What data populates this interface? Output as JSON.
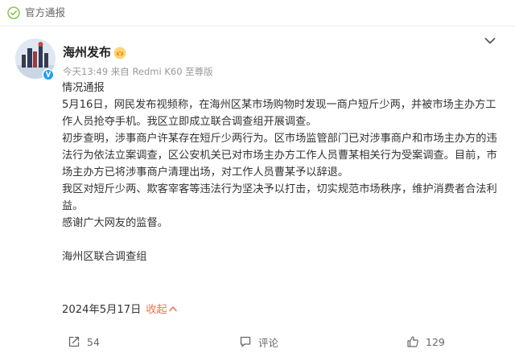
{
  "header": {
    "badge_label": "官方通报"
  },
  "post": {
    "author": "海州发布",
    "meta": "今天13:49 来自 Redmi K60 至尊版",
    "paragraphs": [
      "情况通报",
      "5月16日，网民发布视频称，在海州区某市场购物时发现一商户短斤少两，并被市场主办方工作人员抢夺手机。我区立即成立联合调查组开展调查。",
      "初步查明，涉事商户许某存在短斤少两行为。区市场监管部门已对涉事商户和市场主办方的违法行为依法立案调查，区公安机关已对市场主办方工作人员曹某相关行为受案调查。目前，市场主办方已将涉事商户清理出场，对工作人员曹某予以辞退。",
      "我区对短斤少两、欺客宰客等违法行为坚决予以打击，切实规范市场秩序，维护消费者合法利益。",
      "感谢广大网友的监督。"
    ],
    "signature": "海州区联合调查组",
    "date": "2024年5月17日",
    "collapse_label": "收起"
  },
  "actions": {
    "repost_count": "54",
    "comment_label": "评论",
    "like_count": "129"
  },
  "colors": {
    "accent": "#eb7350",
    "text": "#333333",
    "muted": "#999999",
    "verified": "#1da0f2"
  },
  "icons": [
    "official-badge-icon",
    "chevron-down-icon",
    "verified-icon",
    "crown-badge-icon",
    "chevron-up-icon",
    "repost-icon",
    "comment-icon",
    "like-icon"
  ]
}
